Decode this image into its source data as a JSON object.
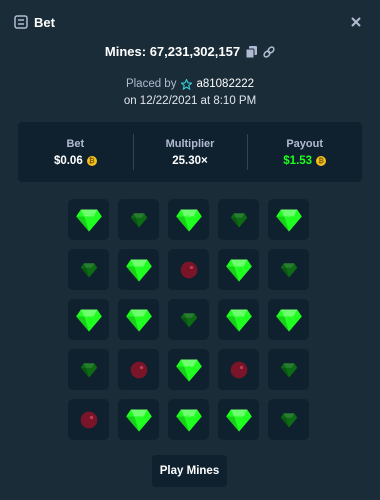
{
  "header": {
    "title": "Bet",
    "icon": "bet-slip-icon",
    "close_icon": "close-icon"
  },
  "bet_info": {
    "game_title": "Mines: 67,231,302,157",
    "placed_by_label": "Placed by",
    "username": "a81082222",
    "date_text": "on 12/22/2021 at 8:10 PM"
  },
  "stats": {
    "bet_label": "Bet",
    "bet_value": "$0.06",
    "multiplier_label": "Multiplier",
    "multiplier_value": "25.30×",
    "payout_label": "Payout",
    "payout_value": "$1.53",
    "coin_symbol": "₿"
  },
  "board": {
    "rows": [
      [
        "gem-revealed",
        "gem",
        "gem-revealed",
        "gem",
        "gem-revealed"
      ],
      [
        "gem",
        "gem-revealed",
        "mine",
        "gem-revealed",
        "gem"
      ],
      [
        "gem-revealed",
        "gem-revealed",
        "gem",
        "gem-revealed",
        "gem-revealed"
      ],
      [
        "gem",
        "mine",
        "gem-revealed",
        "mine",
        "gem"
      ],
      [
        "mine",
        "gem-revealed",
        "gem-revealed",
        "gem-revealed",
        "gem"
      ]
    ]
  },
  "colors": {
    "background": "#1a2c38",
    "panel": "#0f212e",
    "gem_bright": "#1fff20",
    "gem_dim": "#0c6b14",
    "mine": "#7a1428",
    "payout_green": "#1fff20"
  },
  "actions": {
    "play_label": "Play Mines"
  }
}
